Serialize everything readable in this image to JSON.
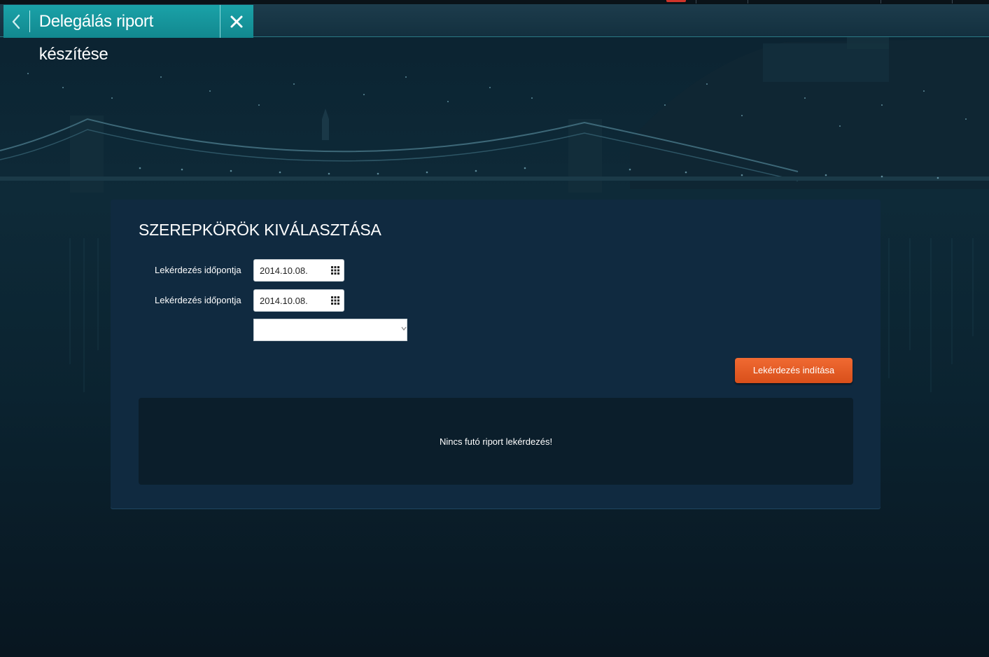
{
  "header": {
    "tab_title": "Delegálás riport készítése"
  },
  "panel": {
    "title": "SZEREPKÖRÖK KIVÁLASZTÁSA",
    "date_from_label": "Lekérdezés időpontja",
    "date_from_value": "2014.10.08.",
    "date_to_label": "Lekérdezés időpontja",
    "date_to_value": "2014.10.08.",
    "select_value": "",
    "start_button": "Lekérdezés indítása",
    "status_message": "Nincs futó riport lekérdezés!"
  },
  "colors": {
    "tab_accent": "#1aa2a8",
    "button_orange": "#e85c24",
    "panel_bg": "#102a40"
  },
  "icons": [
    "back-chevron-icon",
    "close-icon",
    "calendar-icon"
  ]
}
